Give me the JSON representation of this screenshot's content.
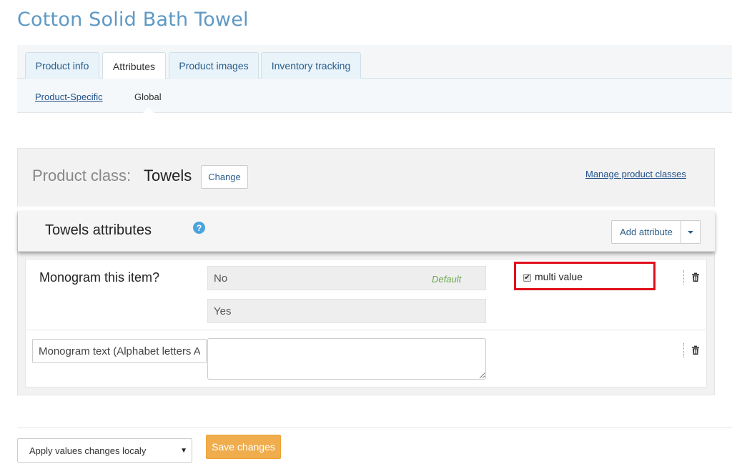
{
  "page": {
    "title": "Cotton Solid Bath Towel"
  },
  "tabs": [
    {
      "label": "Product info",
      "active": false
    },
    {
      "label": "Attributes",
      "active": true
    },
    {
      "label": "Product images",
      "active": false
    },
    {
      "label": "Inventory tracking",
      "active": false
    }
  ],
  "subtabs": [
    {
      "label": "Product-Specific",
      "active": false
    },
    {
      "label": "Global",
      "active": true
    }
  ],
  "product_class": {
    "label": "Product class:",
    "value": "Towels",
    "change_label": "Change",
    "manage_link": "Manage product classes"
  },
  "attributes_panel": {
    "title": "Towels attributes",
    "help_icon": "question-circle-icon",
    "add_button_label": "Add attribute",
    "rows": [
      {
        "name": "Monogram this item?",
        "values": [
          "No",
          "Yes"
        ],
        "default_tag": "Default",
        "multi_value_label": "multi value",
        "multi_value_checked": true
      },
      {
        "name_input_value": "Monogram text (Alphabet letters A",
        "text_value": ""
      }
    ]
  },
  "footer": {
    "apply_select_value": "Apply values changes localy",
    "save_label": "Save changes"
  },
  "colors": {
    "title": "#5e99c4",
    "link": "#1f4f8a",
    "save_button": "#f0ad4e",
    "highlight": "#e0101a",
    "default_tag": "#6aa84f"
  }
}
